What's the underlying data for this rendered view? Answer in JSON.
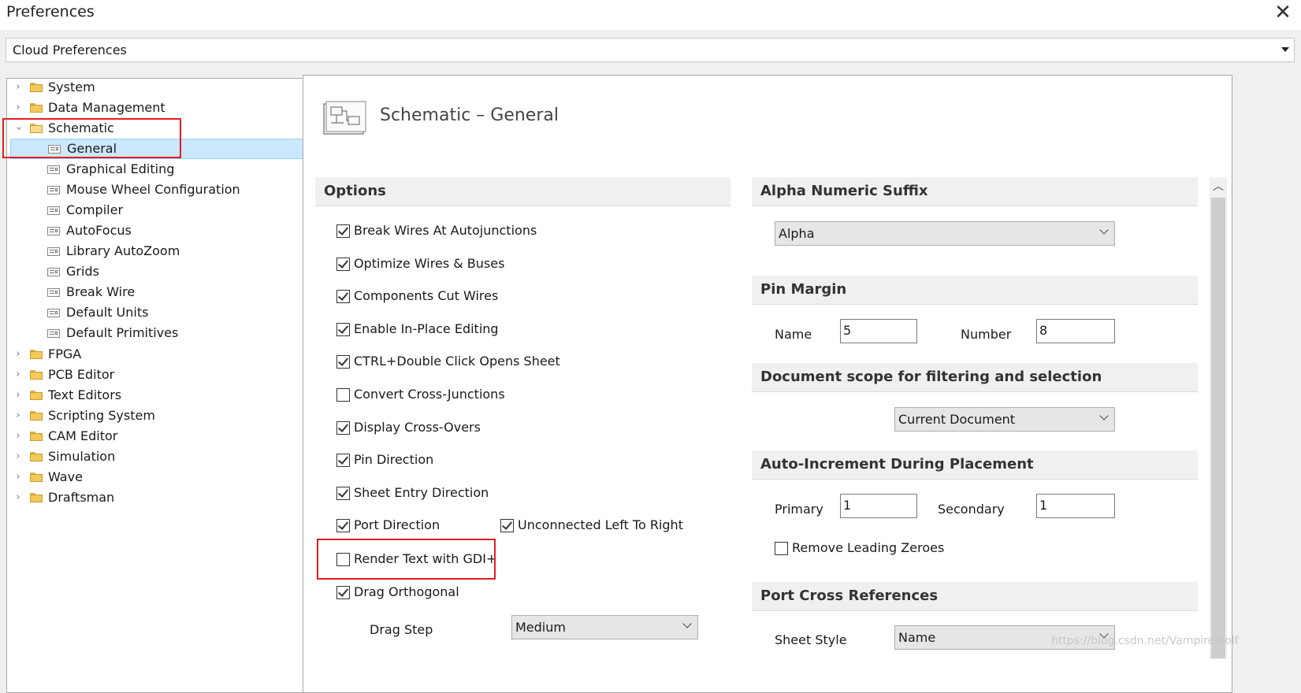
{
  "window": {
    "title": "Preferences",
    "close_glyph": "✕"
  },
  "cloud": {
    "selected": "Cloud Preferences"
  },
  "tree": {
    "items": [
      {
        "label": "System",
        "expanded": false
      },
      {
        "label": "Data Management",
        "expanded": false
      },
      {
        "label": "Schematic",
        "expanded": true
      },
      {
        "label": "General",
        "selected": true
      },
      {
        "label": "Graphical Editing"
      },
      {
        "label": "Mouse Wheel Configuration"
      },
      {
        "label": "Compiler"
      },
      {
        "label": "AutoFocus"
      },
      {
        "label": "Library AutoZoom"
      },
      {
        "label": "Grids"
      },
      {
        "label": "Break Wire"
      },
      {
        "label": "Default Units"
      },
      {
        "label": "Default Primitives"
      },
      {
        "label": "FPGA",
        "expanded": false
      },
      {
        "label": "PCB Editor",
        "expanded": false
      },
      {
        "label": "Text Editors",
        "expanded": false
      },
      {
        "label": "Scripting System",
        "expanded": false
      },
      {
        "label": "CAM Editor",
        "expanded": false
      },
      {
        "label": "Simulation",
        "expanded": false
      },
      {
        "label": "Wave",
        "expanded": false
      },
      {
        "label": "Draftsman",
        "expanded": false
      }
    ]
  },
  "page": {
    "title": "Schematic – General"
  },
  "options": {
    "header": "Options",
    "checkboxes": [
      {
        "label": "Break Wires At Autojunctions",
        "checked": true
      },
      {
        "label": "Optimize Wires & Buses",
        "checked": true
      },
      {
        "label": "Components Cut Wires",
        "checked": true
      },
      {
        "label": "Enable In-Place Editing",
        "checked": true
      },
      {
        "label": "CTRL+Double Click Opens Sheet",
        "checked": true
      },
      {
        "label": "Convert Cross-Junctions",
        "checked": false
      },
      {
        "label": "Display Cross-Overs",
        "checked": true
      },
      {
        "label": "Pin Direction",
        "checked": true
      },
      {
        "label": "Sheet Entry Direction",
        "checked": true
      },
      {
        "label": "Port Direction",
        "checked": true
      },
      {
        "label": "Unconnected Left To Right",
        "checked": true
      },
      {
        "label": "Render Text with GDI+",
        "checked": false
      },
      {
        "label": "Drag Orthogonal",
        "checked": true
      }
    ],
    "drag_step_label": "Drag Step",
    "drag_step_value": "Medium"
  },
  "alpha": {
    "header": "Alpha Numeric Suffix",
    "value": "Alpha"
  },
  "pin_margin": {
    "header": "Pin Margin",
    "name_label": "Name",
    "name_value": "5",
    "number_label": "Number",
    "number_value": "8"
  },
  "doc_scope": {
    "header": "Document scope for filtering and selection",
    "value": "Current Document"
  },
  "auto_inc": {
    "header": "Auto-Increment During Placement",
    "primary_label": "Primary",
    "primary_value": "1",
    "secondary_label": "Secondary",
    "secondary_value": "1",
    "remove_zeroes_label": "Remove Leading Zeroes",
    "remove_zeroes_checked": false
  },
  "port_xref": {
    "header": "Port Cross References",
    "sheet_style_label": "Sheet Style",
    "sheet_style_value": "Name"
  },
  "watermark": "https://blog.csdn.net/VampireWolf",
  "colors": {
    "highlight": "#e02020",
    "selection": "#cce8ff"
  }
}
